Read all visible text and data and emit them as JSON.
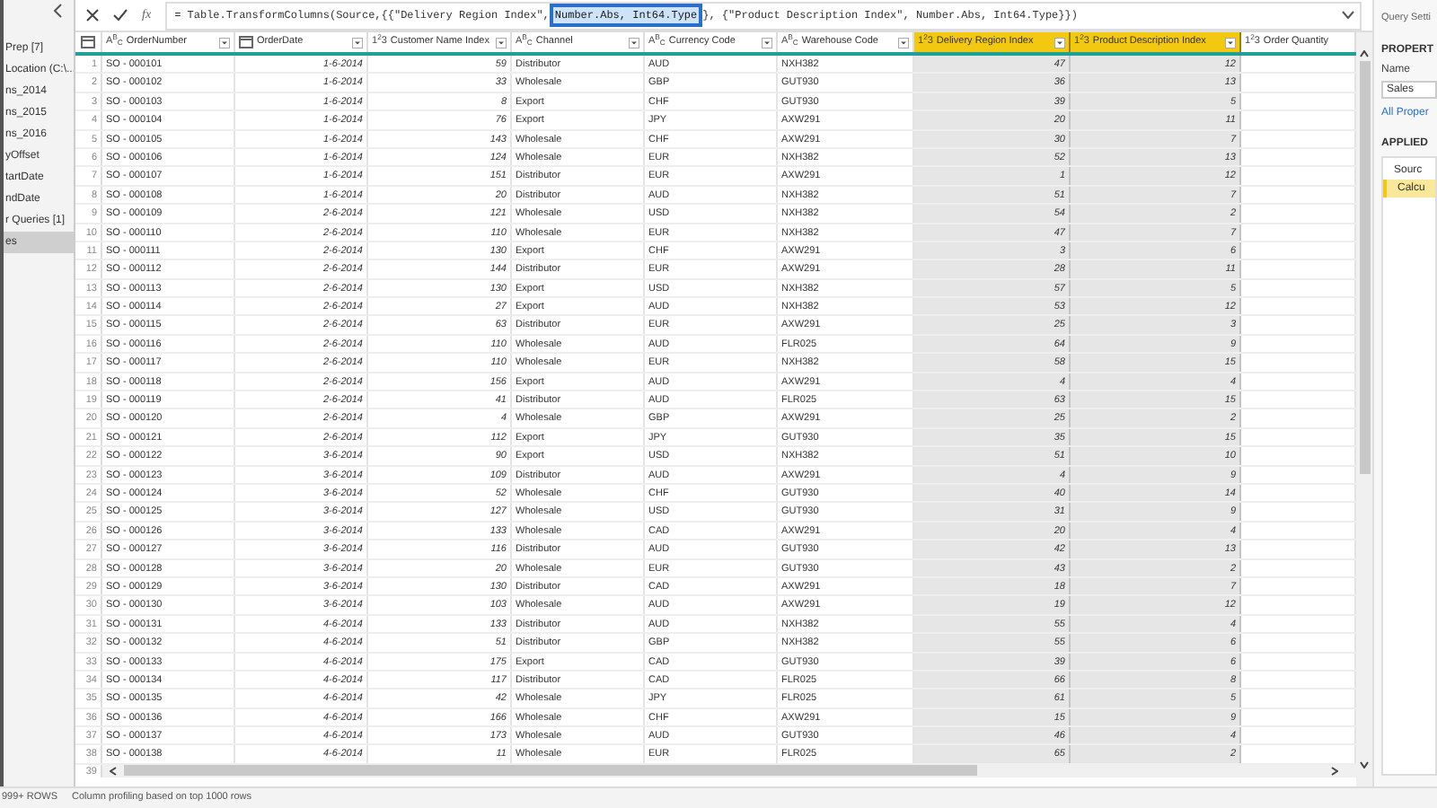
{
  "sidebar": {
    "items": [
      {
        "label": "Prep [7]",
        "selected": false
      },
      {
        "label": "Location (C:\\...",
        "selected": false
      },
      {
        "label": "ns_2014",
        "selected": false
      },
      {
        "label": "ns_2015",
        "selected": false
      },
      {
        "label": "ns_2016",
        "selected": false
      },
      {
        "label": "yOffset",
        "selected": false
      },
      {
        "label": "tartDate",
        "selected": false
      },
      {
        "label": "ndDate",
        "selected": false
      },
      {
        "label": "r Queries [1]",
        "selected": false
      },
      {
        "label": "es",
        "selected": true
      }
    ]
  },
  "formula_bar": {
    "fx": "fx",
    "before": "= Table.TransformColumns(Source,{{\"Delivery Region Index\", ",
    "highlighted": "Number.Abs, Int64.Type",
    "after": "}, {\"Product Description Index\", Number.Abs, Int64.Type}})"
  },
  "table": {
    "columns": [
      {
        "label": "OrderNumber",
        "kind": "text",
        "type_icon": "A$^{B}$$_{C}$",
        "selected": false
      },
      {
        "label": "OrderDate",
        "kind": "date",
        "selected": false
      },
      {
        "label": "Customer Name Index",
        "kind": "number",
        "type_icon": "1$^{2}$3",
        "selected": false
      },
      {
        "label": "Channel",
        "kind": "text",
        "type_icon": "A$^{B}$$_{C}$",
        "selected": false
      },
      {
        "label": "Currency Code",
        "kind": "text",
        "type_icon": "A$^{B}$$_{C}$",
        "selected": false
      },
      {
        "label": "Warehouse Code",
        "kind": "text",
        "type_icon": "A$^{B}$$_{C}$",
        "selected": false
      },
      {
        "label": "Delivery Region Index",
        "kind": "number",
        "type_icon": "1$^{2}$3",
        "selected": true
      },
      {
        "label": "Product Description Index",
        "kind": "number",
        "type_icon": "1$^{2}$3",
        "selected": true
      },
      {
        "label": "Order Quantity",
        "kind": "number",
        "type_icon": "1$^{2}$3",
        "selected": false
      }
    ],
    "rows": [
      {
        "n": "1",
        "cells": [
          "SO - 000101",
          "1-6-2014",
          "59",
          "Distributor",
          "AUD",
          "NXH382",
          "47",
          "12"
        ]
      },
      {
        "n": "2",
        "cells": [
          "SO - 000102",
          "1-6-2014",
          "33",
          "Wholesale",
          "GBP",
          "GUT930",
          "36",
          "13"
        ]
      },
      {
        "n": "3",
        "cells": [
          "SO - 000103",
          "1-6-2014",
          "8",
          "Export",
          "CHF",
          "GUT930",
          "39",
          "5"
        ]
      },
      {
        "n": "4",
        "cells": [
          "SO - 000104",
          "1-6-2014",
          "76",
          "Export",
          "JPY",
          "AXW291",
          "20",
          "11"
        ]
      },
      {
        "n": "5",
        "cells": [
          "SO - 000105",
          "1-6-2014",
          "143",
          "Wholesale",
          "CHF",
          "AXW291",
          "30",
          "7"
        ]
      },
      {
        "n": "6",
        "cells": [
          "SO - 000106",
          "1-6-2014",
          "124",
          "Wholesale",
          "EUR",
          "NXH382",
          "52",
          "13"
        ]
      },
      {
        "n": "7",
        "cells": [
          "SO - 000107",
          "1-6-2014",
          "151",
          "Distributor",
          "EUR",
          "AXW291",
          "1",
          "12"
        ]
      },
      {
        "n": "8",
        "cells": [
          "SO - 000108",
          "1-6-2014",
          "20",
          "Distributor",
          "AUD",
          "NXH382",
          "51",
          "7"
        ]
      },
      {
        "n": "9",
        "cells": [
          "SO - 000109",
          "2-6-2014",
          "121",
          "Wholesale",
          "USD",
          "NXH382",
          "54",
          "2"
        ]
      },
      {
        "n": "10",
        "cells": [
          "SO - 000110",
          "2-6-2014",
          "110",
          "Wholesale",
          "EUR",
          "NXH382",
          "47",
          "7"
        ]
      },
      {
        "n": "11",
        "cells": [
          "SO - 000111",
          "2-6-2014",
          "130",
          "Export",
          "CHF",
          "AXW291",
          "3",
          "6"
        ]
      },
      {
        "n": "12",
        "cells": [
          "SO - 000112",
          "2-6-2014",
          "144",
          "Distributor",
          "EUR",
          "AXW291",
          "28",
          "11"
        ]
      },
      {
        "n": "13",
        "cells": [
          "SO - 000113",
          "2-6-2014",
          "130",
          "Export",
          "USD",
          "NXH382",
          "57",
          "5"
        ]
      },
      {
        "n": "14",
        "cells": [
          "SO - 000114",
          "2-6-2014",
          "27",
          "Export",
          "AUD",
          "NXH382",
          "53",
          "12"
        ]
      },
      {
        "n": "15",
        "cells": [
          "SO - 000115",
          "2-6-2014",
          "63",
          "Distributor",
          "EUR",
          "AXW291",
          "25",
          "3"
        ]
      },
      {
        "n": "16",
        "cells": [
          "SO - 000116",
          "2-6-2014",
          "110",
          "Wholesale",
          "AUD",
          "FLR025",
          "64",
          "9"
        ]
      },
      {
        "n": "17",
        "cells": [
          "SO - 000117",
          "2-6-2014",
          "110",
          "Wholesale",
          "EUR",
          "NXH382",
          "58",
          "15"
        ]
      },
      {
        "n": "18",
        "cells": [
          "SO - 000118",
          "2-6-2014",
          "156",
          "Export",
          "AUD",
          "AXW291",
          "4",
          "4"
        ]
      },
      {
        "n": "19",
        "cells": [
          "SO - 000119",
          "2-6-2014",
          "41",
          "Distributor",
          "AUD",
          "FLR025",
          "63",
          "15"
        ]
      },
      {
        "n": "20",
        "cells": [
          "SO - 000120",
          "2-6-2014",
          "4",
          "Wholesale",
          "GBP",
          "AXW291",
          "25",
          "2"
        ]
      },
      {
        "n": "21",
        "cells": [
          "SO - 000121",
          "2-6-2014",
          "112",
          "Export",
          "JPY",
          "GUT930",
          "35",
          "15"
        ]
      },
      {
        "n": "22",
        "cells": [
          "SO - 000122",
          "3-6-2014",
          "90",
          "Export",
          "USD",
          "NXH382",
          "51",
          "10"
        ]
      },
      {
        "n": "23",
        "cells": [
          "SO - 000123",
          "3-6-2014",
          "109",
          "Distributor",
          "AUD",
          "AXW291",
          "4",
          "9"
        ]
      },
      {
        "n": "24",
        "cells": [
          "SO - 000124",
          "3-6-2014",
          "52",
          "Wholesale",
          "CHF",
          "GUT930",
          "40",
          "14"
        ]
      },
      {
        "n": "25",
        "cells": [
          "SO - 000125",
          "3-6-2014",
          "127",
          "Wholesale",
          "USD",
          "GUT930",
          "31",
          "9"
        ]
      },
      {
        "n": "26",
        "cells": [
          "SO - 000126",
          "3-6-2014",
          "133",
          "Wholesale",
          "CAD",
          "AXW291",
          "20",
          "4"
        ]
      },
      {
        "n": "27",
        "cells": [
          "SO - 000127",
          "3-6-2014",
          "116",
          "Distributor",
          "AUD",
          "GUT930",
          "42",
          "13"
        ]
      },
      {
        "n": "28",
        "cells": [
          "SO - 000128",
          "3-6-2014",
          "20",
          "Wholesale",
          "EUR",
          "GUT930",
          "43",
          "2"
        ]
      },
      {
        "n": "29",
        "cells": [
          "SO - 000129",
          "3-6-2014",
          "130",
          "Distributor",
          "CAD",
          "AXW291",
          "18",
          "7"
        ]
      },
      {
        "n": "30",
        "cells": [
          "SO - 000130",
          "3-6-2014",
          "103",
          "Wholesale",
          "AUD",
          "AXW291",
          "19",
          "12"
        ]
      },
      {
        "n": "31",
        "cells": [
          "SO - 000131",
          "4-6-2014",
          "133",
          "Distributor",
          "AUD",
          "NXH382",
          "55",
          "4"
        ]
      },
      {
        "n": "32",
        "cells": [
          "SO - 000132",
          "4-6-2014",
          "51",
          "Distributor",
          "GBP",
          "NXH382",
          "55",
          "6"
        ]
      },
      {
        "n": "33",
        "cells": [
          "SO - 000133",
          "4-6-2014",
          "175",
          "Export",
          "CAD",
          "GUT930",
          "39",
          "6"
        ]
      },
      {
        "n": "34",
        "cells": [
          "SO - 000134",
          "4-6-2014",
          "117",
          "Distributor",
          "CAD",
          "FLR025",
          "66",
          "8"
        ]
      },
      {
        "n": "35",
        "cells": [
          "SO - 000135",
          "4-6-2014",
          "42",
          "Wholesale",
          "JPY",
          "FLR025",
          "61",
          "5"
        ]
      },
      {
        "n": "36",
        "cells": [
          "SO - 000136",
          "4-6-2014",
          "166",
          "Wholesale",
          "CHF",
          "AXW291",
          "15",
          "9"
        ]
      },
      {
        "n": "37",
        "cells": [
          "SO - 000137",
          "4-6-2014",
          "173",
          "Wholesale",
          "AUD",
          "GUT930",
          "46",
          "4"
        ]
      },
      {
        "n": "38",
        "cells": [
          "SO - 000138",
          "4-6-2014",
          "11",
          "Wholesale",
          "EUR",
          "FLR025",
          "65",
          "2"
        ]
      }
    ],
    "partial_row": {
      "n": "39"
    }
  },
  "query_settings": {
    "title": "Query Setti",
    "properties_heading": "PROPERT",
    "name_label": "Name",
    "name_value": "Sales",
    "all_properties_link": "All Proper",
    "applied_heading": "APPLIED",
    "steps": [
      {
        "label": "Sourc",
        "selected": false
      },
      {
        "label": "Calcu",
        "selected": true
      }
    ]
  },
  "status_bar": {
    "rows": "999+ ROWS",
    "profiling": "Column profiling based on top 1000 rows"
  }
}
